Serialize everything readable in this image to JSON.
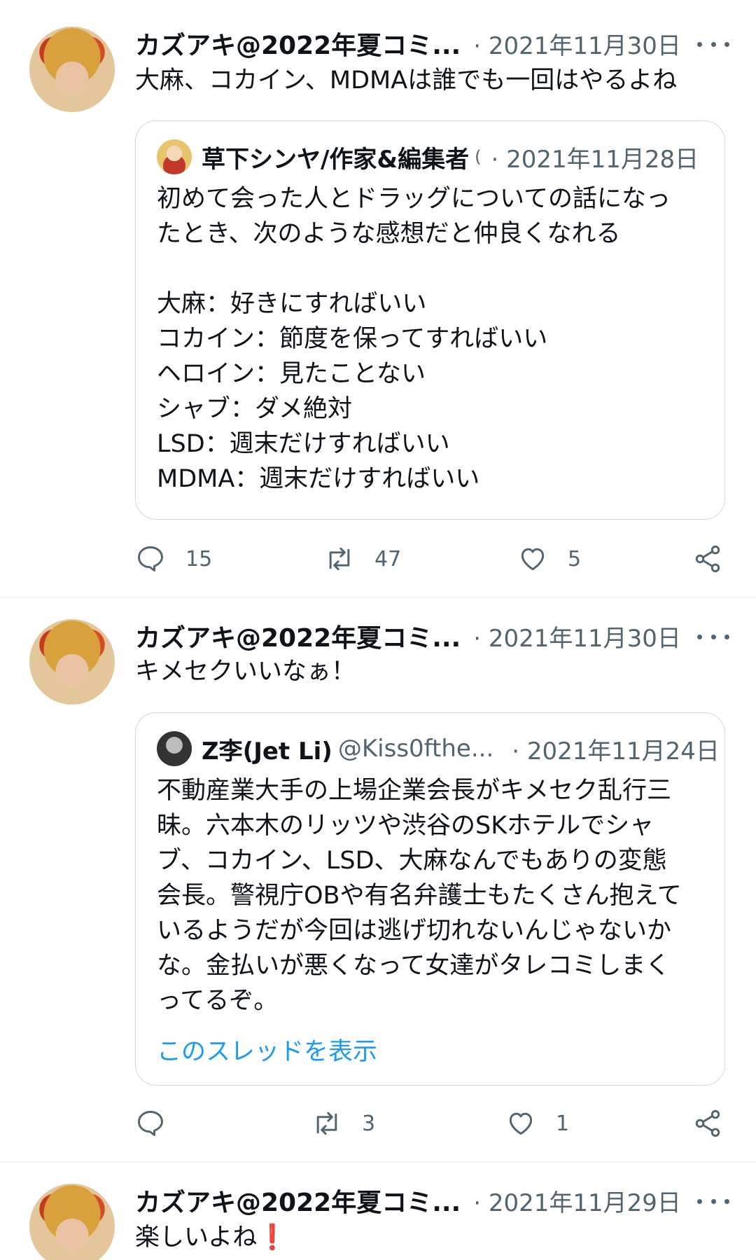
{
  "tweets": [
    {
      "author": "カズアキ@2022年夏コミ...",
      "date": "· 2021年11月30日",
      "text": [
        "大麻、コカイン、MDMAは誰でも一回はやるよね"
      ],
      "quote": {
        "author": "草下シンヤ/作家&編集者",
        "handle": "(",
        "date": "· 2021年11月28日",
        "lines": [
          "初めて会った人とドラッグについての話になっ",
          "たとき、次のような感想だと仲良くなれる",
          "",
          "大麻：好きにすればいい",
          "コカイン：節度を保ってすればいい",
          "ヘロイン：見たことない",
          "シャブ：ダメ絶対",
          "LSD：週末だけすればいい",
          "MDMA：週末だけすればいい"
        ]
      },
      "counts": {
        "reply": "15",
        "retweet": "47",
        "like": "5"
      }
    },
    {
      "author": "カズアキ@2022年夏コミ...",
      "date": "· 2021年11月30日",
      "text": [
        "キメセクいいなぁ！"
      ],
      "quote": {
        "author": "Z李(Jet Li)",
        "handle": "@Kiss0fthe...",
        "date": "· 2021年11月24日",
        "lines": [
          "不動産業大手の上場企業会長がキメセク乱行三",
          "昧。六本木のリッツや渋谷のSKホテルでシャ",
          "ブ、コカイン、LSD、大麻なんでもありの変態",
          "会長。警視庁OBや有名弁護士もたくさん抱えて",
          "いるようだが今回は逃げ切れないんじゃないか",
          "な。金払いが悪くなって女達がタレコミしまく",
          "ってるぞ。"
        ],
        "thread_link": "このスレッドを表示"
      },
      "counts": {
        "reply": "",
        "retweet": "3",
        "like": "1"
      }
    },
    {
      "author": "カズアキ@2022年夏コミ...",
      "date": "· 2021年11月29日",
      "text": [
        "楽しいよね❗"
      ]
    }
  ],
  "icons": {
    "reply": "reply-icon",
    "retweet": "retweet-icon",
    "like": "heart-icon",
    "share": "share-icon",
    "more": "more-icon"
  },
  "colors": {
    "link": "#1d9bf0",
    "secondary": "#536471",
    "border": "#cfd9de"
  }
}
